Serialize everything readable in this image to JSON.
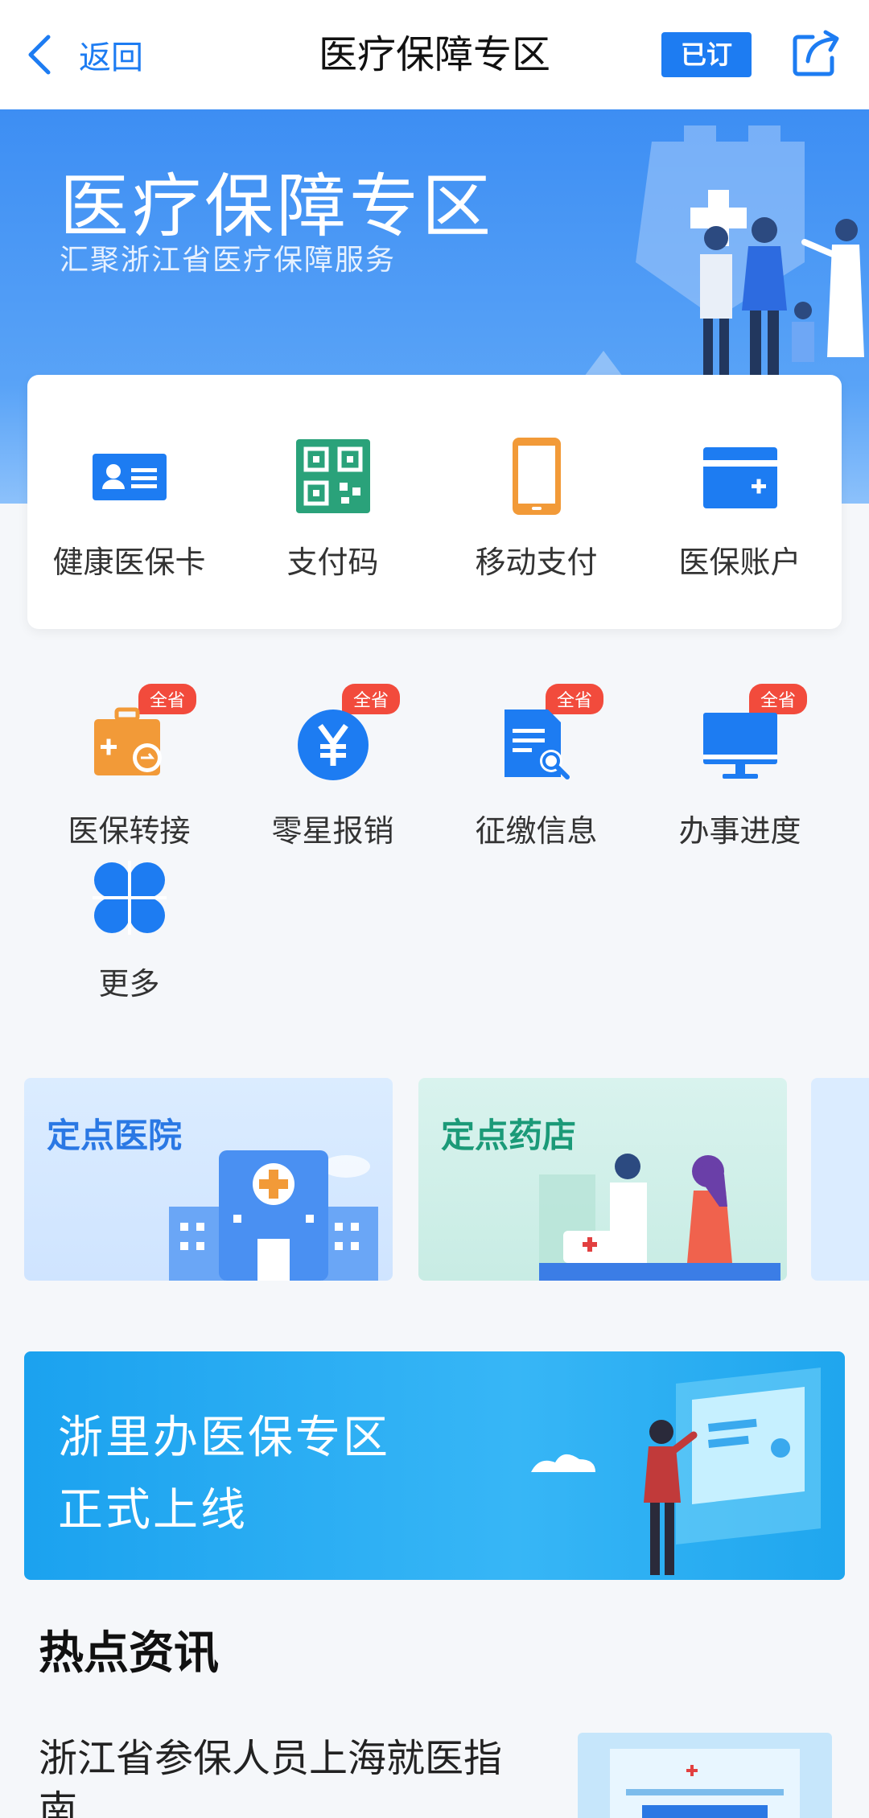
{
  "nav": {
    "back_label": "返回",
    "title": "医疗保障专区",
    "subscribed_label": "已订"
  },
  "hero": {
    "title": "医疗保障专区",
    "subtitle": "汇聚浙江省医疗保障服务"
  },
  "primary_services": [
    {
      "label": "健康医保卡",
      "icon": "id-card-icon"
    },
    {
      "label": "支付码",
      "icon": "qr-code-icon"
    },
    {
      "label": "移动支付",
      "icon": "mobile-phone-icon"
    },
    {
      "label": "医保账户",
      "icon": "wallet-card-icon"
    }
  ],
  "secondary_services": [
    {
      "label": "医保转接",
      "icon": "briefcase-transfer-icon",
      "badge": "全省"
    },
    {
      "label": "零星报销",
      "icon": "yen-icon",
      "badge": "全省"
    },
    {
      "label": "征缴信息",
      "icon": "document-search-icon",
      "badge": "全省"
    },
    {
      "label": "办事进度",
      "icon": "monitor-icon",
      "badge": "全省"
    }
  ],
  "more": {
    "label": "更多",
    "icon": "four-petal-icon"
  },
  "tiles": [
    {
      "title": "定点医院"
    },
    {
      "title": "定点药店"
    }
  ],
  "promo": {
    "line1": "浙里办医保专区",
    "line2": "正式上线"
  },
  "news": {
    "heading": "热点资讯",
    "items": [
      {
        "title": "浙江省参保人员上海就医指南"
      }
    ]
  },
  "colors": {
    "accent": "#1d7cf2",
    "badge": "#f24b3c",
    "orange": "#f29a38",
    "green": "#2aa27a"
  }
}
